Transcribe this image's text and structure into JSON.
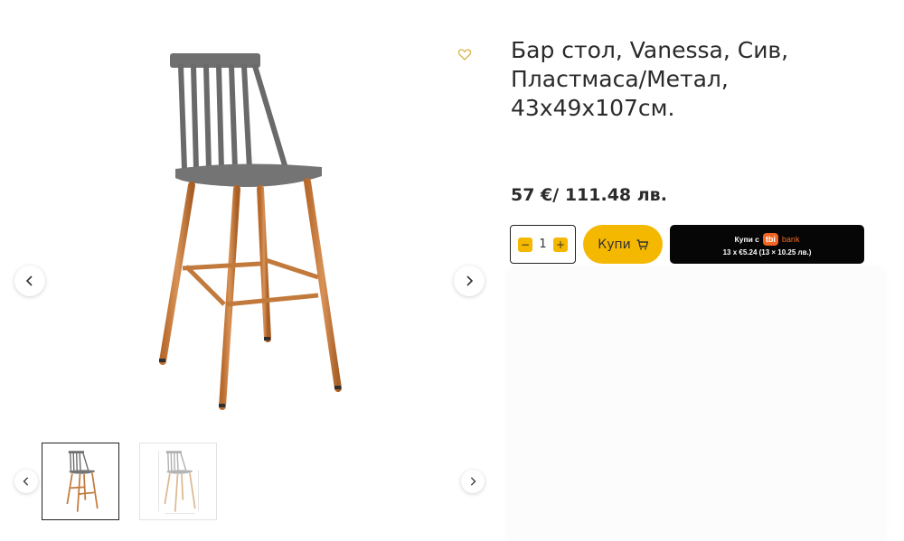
{
  "product": {
    "title": "Бар стол, Vanessa, Сив, Пластмаса/Метал, 43x49x107см.",
    "price": "57 €/ 111.48 лв.",
    "quantity": "1"
  },
  "actions": {
    "buy_label": "Купи",
    "minus": "−",
    "plus": "+"
  },
  "tbi": {
    "prefix": "Купи с",
    "logo": "tbi",
    "bank": "bank",
    "installments": "13 x €5.24 (13 × 10.25 лв.)"
  },
  "icons": {
    "wishlist": "heart-icon",
    "cart": "cart-icon",
    "prev": "chevron-left-icon",
    "next": "chevron-right-icon"
  },
  "colors": {
    "accent": "#f5b800",
    "tbi_bg": "#060606",
    "tbi_orange": "#f26522",
    "heart": "#d9b44a"
  }
}
